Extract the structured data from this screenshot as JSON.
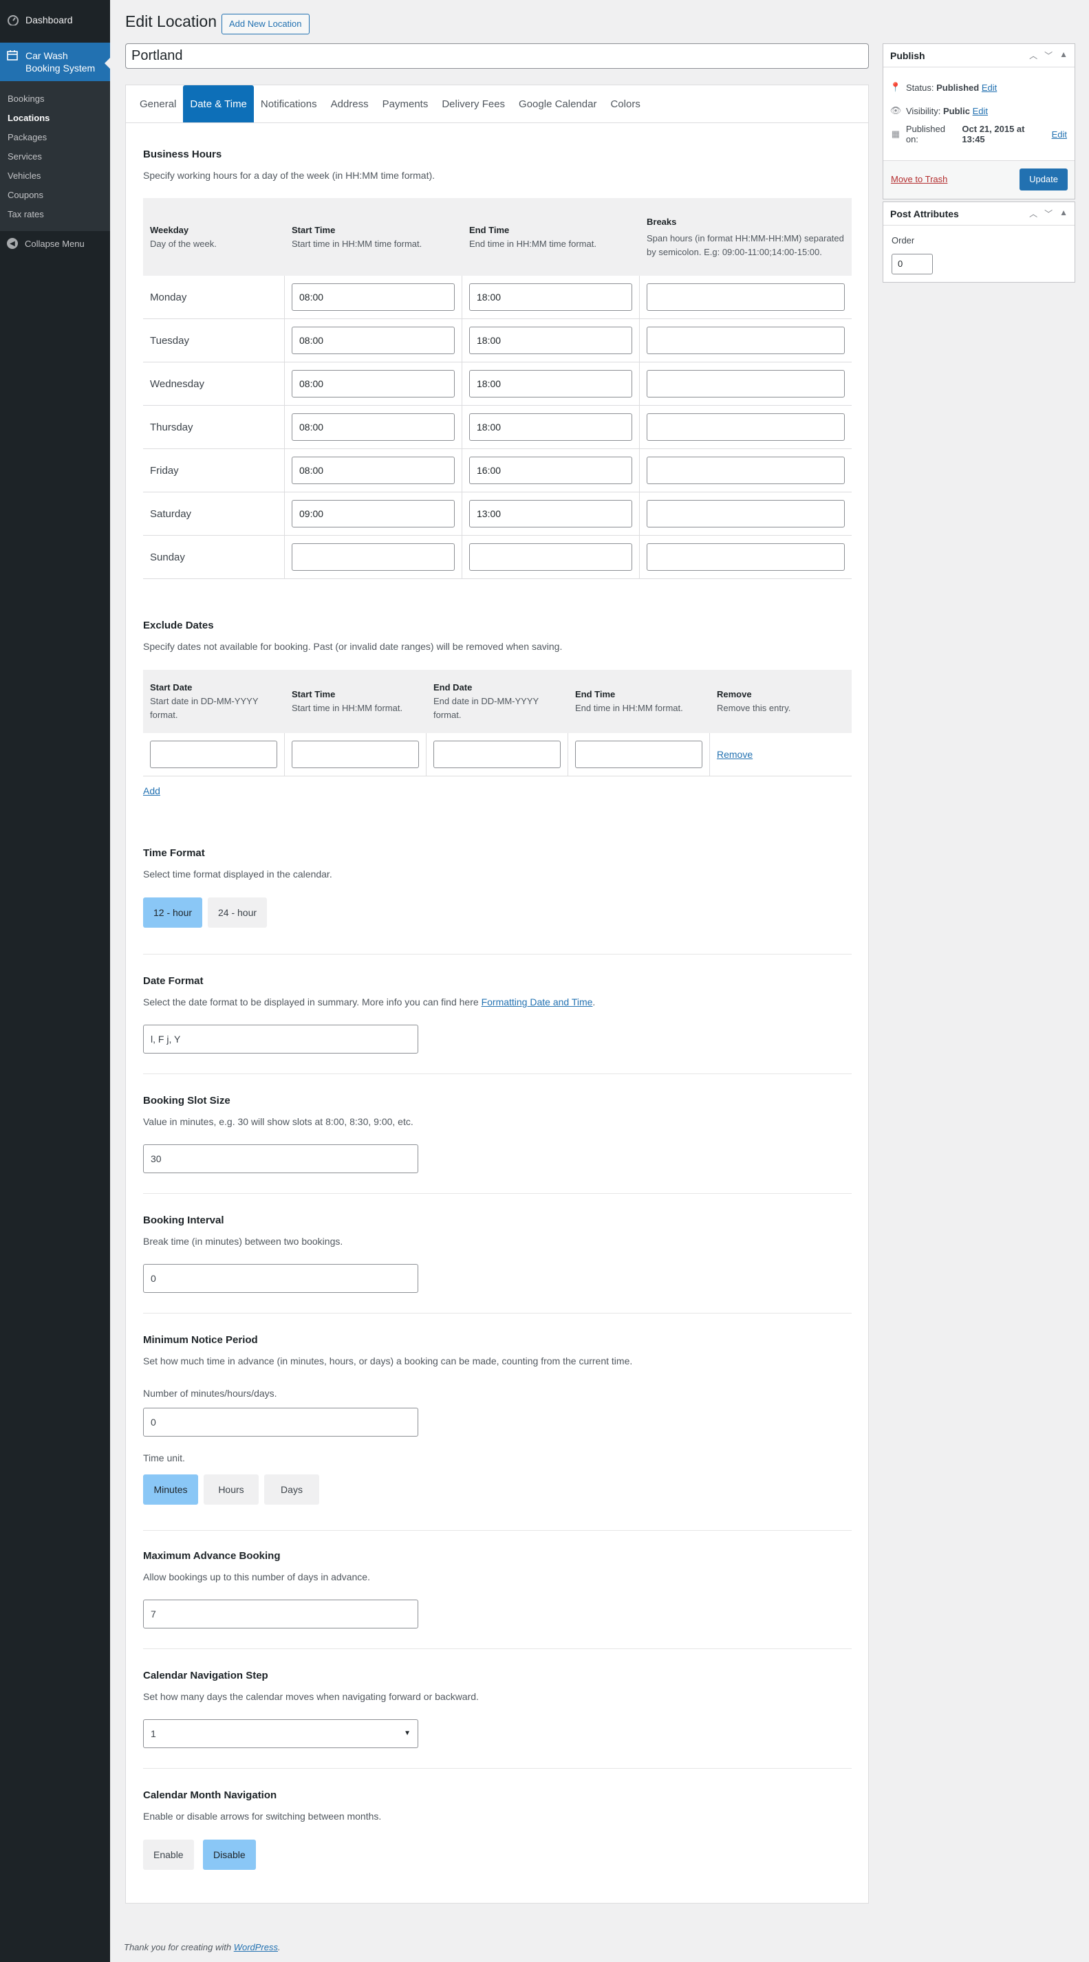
{
  "sidebar": {
    "dashboard": "Dashboard",
    "active": "Car Wash Booking System",
    "items": [
      "Bookings",
      "Locations",
      "Packages",
      "Services",
      "Vehicles",
      "Coupons",
      "Tax rates"
    ],
    "collapse": "Collapse Menu"
  },
  "header": {
    "title": "Edit Location",
    "add_new": "Add New Location",
    "post_title": "Portland"
  },
  "tabs": [
    "General",
    "Date & Time",
    "Notifications",
    "Address",
    "Payments",
    "Delivery Fees",
    "Google Calendar",
    "Colors"
  ],
  "business_hours": {
    "title": "Business Hours",
    "desc": "Specify working hours for a day of the week (in HH:MM time format).",
    "headers": [
      {
        "title": "Weekday",
        "desc": "Day of the week."
      },
      {
        "title": "Start Time",
        "desc": "Start time in HH:MM time format."
      },
      {
        "title": "End Time",
        "desc": "End time in HH:MM time format."
      },
      {
        "title": "Breaks",
        "desc": "Span hours (in format HH:MM-HH:MM) separated by semicolon. E.g: 09:00-11:00;14:00-15:00."
      }
    ],
    "rows": [
      {
        "day": "Monday",
        "start": "08:00",
        "end": "18:00",
        "breaks": ""
      },
      {
        "day": "Tuesday",
        "start": "08:00",
        "end": "18:00",
        "breaks": ""
      },
      {
        "day": "Wednesday",
        "start": "08:00",
        "end": "18:00",
        "breaks": ""
      },
      {
        "day": "Thursday",
        "start": "08:00",
        "end": "18:00",
        "breaks": ""
      },
      {
        "day": "Friday",
        "start": "08:00",
        "end": "16:00",
        "breaks": ""
      },
      {
        "day": "Saturday",
        "start": "09:00",
        "end": "13:00",
        "breaks": ""
      },
      {
        "day": "Sunday",
        "start": "",
        "end": "",
        "breaks": ""
      }
    ]
  },
  "exclude_dates": {
    "title": "Exclude Dates",
    "desc": "Specify dates not available for booking. Past (or invalid date ranges) will be removed when saving.",
    "headers": [
      {
        "title": "Start Date",
        "desc": "Start date in DD-MM-YYYY format."
      },
      {
        "title": "Start Time",
        "desc": "Start time in HH:MM format."
      },
      {
        "title": "End Date",
        "desc": "End date in DD-MM-YYYY format."
      },
      {
        "title": "End Time",
        "desc": "End time in HH:MM format."
      },
      {
        "title": "Remove",
        "desc": "Remove this entry."
      }
    ],
    "remove": "Remove",
    "add": "Add"
  },
  "time_format": {
    "title": "Time Format",
    "desc": "Select time format displayed in the calendar.",
    "options": [
      "12 - hour",
      "24 - hour"
    ]
  },
  "date_format": {
    "title": "Date Format",
    "desc": "Select the date format to be displayed in summary. More info you can find here ",
    "link": "Formatting Date and Time",
    "value": "l, F j, Y"
  },
  "slot_size": {
    "title": "Booking Slot Size",
    "desc": "Value in minutes, e.g. 30 will show slots at 8:00, 8:30, 9:00, etc.",
    "value": "30"
  },
  "interval": {
    "title": "Booking Interval",
    "desc": "Break time (in minutes) between two bookings.",
    "value": "0"
  },
  "notice": {
    "title": "Minimum Notice Period",
    "desc": "Set how much time in advance (in minutes, hours, or days) a booking can be made, counting from the current time.",
    "label": "Number of minutes/hours/days.",
    "value": "0",
    "unit_label": "Time unit.",
    "units": [
      "Minutes",
      "Hours",
      "Days"
    ]
  },
  "max_advance": {
    "title": "Maximum Advance Booking",
    "desc": "Allow bookings up to this number of days in advance.",
    "value": "7"
  },
  "nav_step": {
    "title": "Calendar Navigation Step",
    "desc": "Set how many days the calendar moves when navigating forward or backward.",
    "value": "1"
  },
  "month_nav": {
    "title": "Calendar Month Navigation",
    "desc": "Enable or disable arrows for switching between months.",
    "options": [
      "Enable",
      "Disable"
    ]
  },
  "publish": {
    "title": "Publish",
    "status_label": "Status: ",
    "status": "Published",
    "edit": "Edit",
    "visibility_label": "Visibility: ",
    "visibility": "Public",
    "published_label": "Published on: ",
    "published": "Oct 21, 2015 at 13:45",
    "trash": "Move to Trash",
    "update": "Update"
  },
  "attributes": {
    "title": "Post Attributes",
    "order_label": "Order",
    "order": "0"
  },
  "footer": {
    "text": "Thank you for creating with ",
    "link": "WordPress",
    "end": "."
  }
}
